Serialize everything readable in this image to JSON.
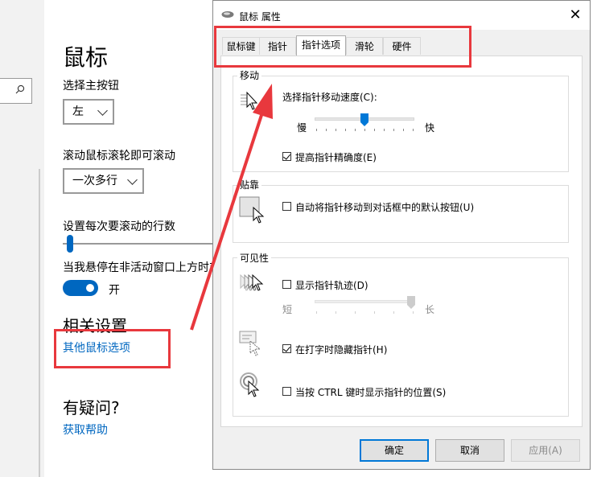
{
  "settings": {
    "title": "鼠标",
    "primary_button_label": "选择主按钮",
    "primary_button_value": "左",
    "scroll_wheel_label": "滚动鼠标滚轮即可滚动",
    "scroll_wheel_value": "一次多行",
    "lines_label": "设置每次要滚动的行数",
    "inactive_scroll_label": "当我悬停在非活动窗口上方时对其",
    "toggle_state": "开",
    "related_heading": "相关设置",
    "other_mouse_options": "其他鼠标选项",
    "question_heading": "有疑问?",
    "get_help": "获取帮助"
  },
  "dialog": {
    "title": "鼠标 属性",
    "close": "✕",
    "tabs": [
      "鼠标键",
      "指针",
      "指针选项",
      "滑轮",
      "硬件"
    ],
    "active_tab": "指针选项",
    "motion": {
      "group_title": "移动",
      "speed_label": "选择指针移动速度(C):",
      "slow": "慢",
      "fast": "快",
      "precision_label": "提高指针精确度(E)",
      "precision_checked": true
    },
    "snap": {
      "group_title": "贴靠",
      "snap_label": "自动将指针移动到对话框中的默认按钮(U)",
      "snap_checked": false
    },
    "visibility": {
      "group_title": "可见性",
      "trails_label": "显示指针轨迹(D)",
      "trails_checked": false,
      "short": "短",
      "long": "长",
      "hide_label": "在打字时隐藏指针(H)",
      "hide_checked": true,
      "ctrl_label": "当按 CTRL 键时显示指针的位置(S)",
      "ctrl_checked": false
    },
    "buttons": {
      "ok": "确定",
      "cancel": "取消",
      "apply": "应用(A)"
    }
  },
  "colors": {
    "accent": "#0067c0",
    "annotation": "#e8383d",
    "dialog_bg": "#f0f0f0"
  }
}
